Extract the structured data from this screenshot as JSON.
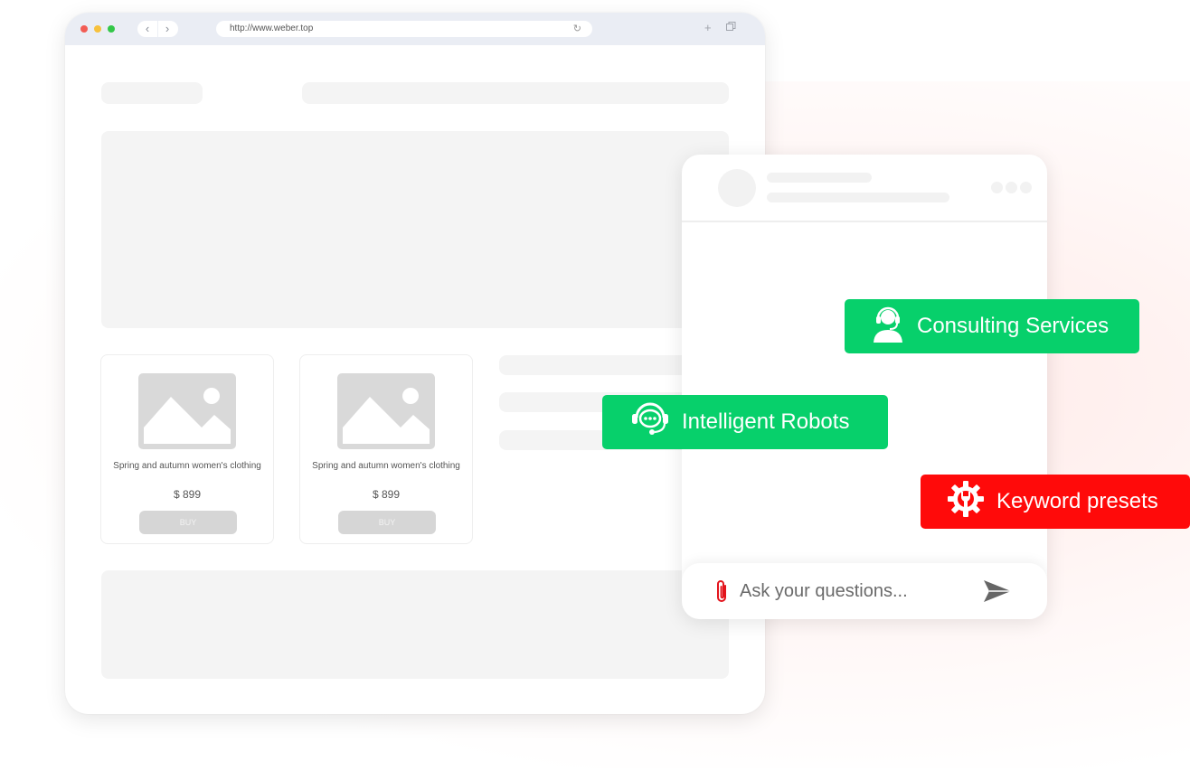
{
  "browser": {
    "url": "http://www.weber.top",
    "back_icon": "chevron-left-icon",
    "forward_icon": "chevron-right-icon",
    "reload_icon": "reload-icon",
    "new_tab_icon": "plus-icon",
    "window_icon": "window-copy-icon",
    "traffic_lights": [
      "#f25c54",
      "#f7c13c",
      "#33c748"
    ]
  },
  "products": [
    {
      "title": "Spring and autumn women's clothing",
      "price": "$ 899",
      "button": "BUY"
    },
    {
      "title": "Spring and autumn women's clothing",
      "price": "$ 899",
      "button": "BUY"
    }
  ],
  "chat": {
    "input_placeholder": "Ask your questions...",
    "attach_icon": "paperclip-icon",
    "send_icon": "send-icon"
  },
  "features": [
    {
      "label": "Consulting Services",
      "icon": "headset-agent-icon",
      "color": "#07d06b"
    },
    {
      "label": "Intelligent Robots",
      "icon": "chat-robot-icon",
      "color": "#07d06b"
    },
    {
      "label": "Keyword presets",
      "icon": "gear-wrench-icon",
      "color": "#ff0a0a"
    }
  ]
}
